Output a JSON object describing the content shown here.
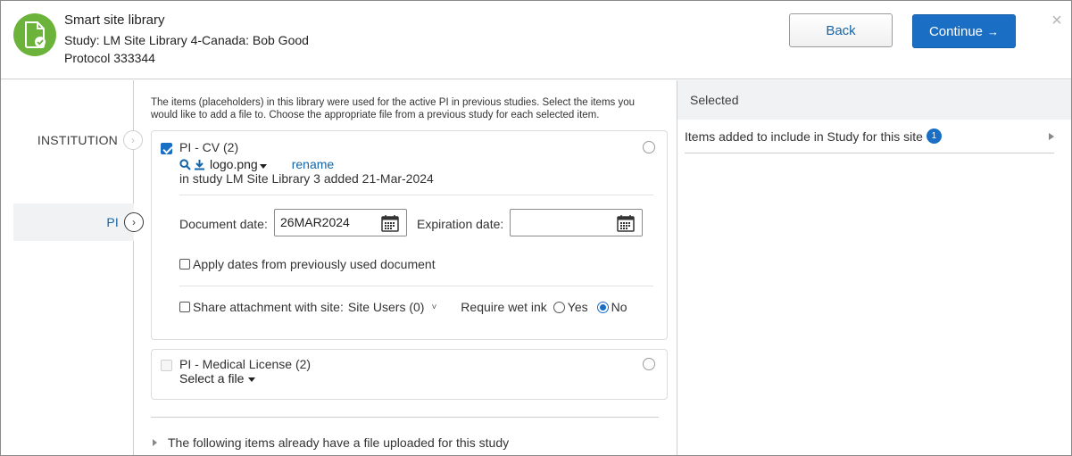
{
  "header": {
    "title": "Smart site library",
    "study_line": "Study: LM Site Library 4-Canada: Bob Good",
    "protocol_line": "Protocol 333344",
    "back_label": "Back",
    "continue_label": "Continue",
    "continue_arrow": "→",
    "close_glyph": "×",
    "badge_color": "#6bb33a"
  },
  "nav": {
    "items": [
      {
        "label": "INSTITUTION",
        "chevron": "›"
      },
      {
        "label": "PI",
        "chevron": "›"
      }
    ]
  },
  "main": {
    "intro": "The items (placeholders) in this library were used for the active PI in previous studies. Select the items you would like to add a file to. Choose the appropriate file from a previous study for each selected item.",
    "items": [
      {
        "title": "PI - CV (2)",
        "file_name": "logo.png",
        "rename_label": "rename",
        "study_info": "in study LM Site Library 3 added 21-Mar-2024",
        "document_date_label": "Document date:",
        "document_date_value": "26MAR2024",
        "expiration_date_label": "Expiration date:",
        "expiration_date_value": "",
        "apply_dates_label": "Apply dates from previously used document",
        "share_label": "Share attachment with site:",
        "share_select_value": "Site Users (0)",
        "share_chevron": "˅",
        "wet_ink_label": "Require wet ink",
        "wet_ink_options": [
          "Yes",
          "No"
        ],
        "wet_ink_selected": "No"
      },
      {
        "title": "PI - Medical License (2)",
        "select_file_label": "Select a file"
      }
    ],
    "expander_label": "The following items already have a file uploaded for this study"
  },
  "right": {
    "heading": "Selected",
    "row_label": "Items added to include in Study for this site",
    "row_count": "1"
  }
}
